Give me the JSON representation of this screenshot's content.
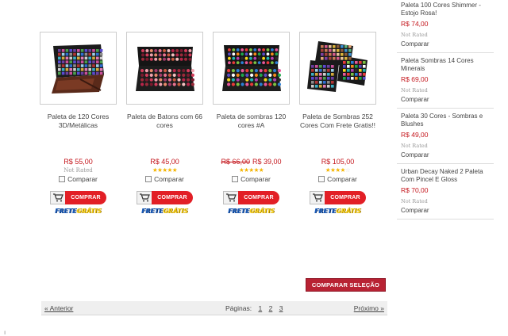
{
  "products": [
    {
      "name": "Paleta de 120 Cores 3D/Metálicas",
      "price": "R$ 55,00",
      "old_price": "",
      "rating_text": "Not Rated",
      "rating_stars": null,
      "compare_label": "Comparar",
      "buy_label": "COMPRAR",
      "frete_label": "FRETE",
      "frete_accent": "GRÁTIS",
      "image": "eyeshadow-palette-120-metallic"
    },
    {
      "name": "Paleta de Batons com 66 cores",
      "price": "R$ 45,00",
      "old_price": "",
      "rating_text": "",
      "rating_stars": 5,
      "compare_label": "Comparar",
      "buy_label": "COMPRAR",
      "frete_label": "FRETE",
      "frete_accent": "GRÁTIS",
      "image": "lipstick-palette-66"
    },
    {
      "name": "Paleta de sombras 120 cores #A",
      "price": "R$ 39,00",
      "old_price": "R$ 66,00",
      "rating_text": "",
      "rating_stars": 5,
      "compare_label": "Comparar",
      "buy_label": "COMPRAR",
      "frete_label": "FRETE",
      "frete_accent": "GRÁTIS",
      "image": "eyeshadow-palette-120a"
    },
    {
      "name": "Paleta de Sombras 252 Cores Com Frete Gratis!!",
      "price": "R$ 105,00",
      "old_price": "",
      "rating_text": "",
      "rating_stars": 4,
      "compare_label": "Comparar",
      "buy_label": "COMPRAR",
      "frete_label": "FRETE",
      "frete_accent": "GRÁTIS",
      "image": "eyeshadow-palette-252"
    }
  ],
  "compare_selection_label": "COMPARAR SELEÇÃO",
  "pagination": {
    "prev": "« Anterior",
    "label": "Páginas:",
    "pages": [
      "1",
      "2",
      "3"
    ],
    "next": "Próximo »"
  },
  "sidebar": [
    {
      "name": "Paleta 100 Cores Shimmer - Estojo Rosa!",
      "price": "R$ 74,00",
      "rating_text": "Not Rated",
      "compare_label": "Comparar"
    },
    {
      "name": "Paleta Sombras 14 Cores Minerais",
      "price": "R$ 69,00",
      "rating_text": "Not Rated",
      "compare_label": "Comparar"
    },
    {
      "name": "Paleta 30 Cores - Sombras e Blushes",
      "price": "R$ 49,00",
      "rating_text": "Not Rated",
      "compare_label": "Comparar"
    },
    {
      "name": "Urban Decay Naked 2 Paleta Com Pincel E Gloss",
      "price": "R$ 70,00",
      "rating_text": "Not Rated",
      "compare_label": "Comparar"
    }
  ],
  "colors": {
    "price": "#c4161c",
    "buy_button": "#e21f26",
    "compare_selection_button": "#b82233",
    "frete_text": "#1c5fbe",
    "frete_accent": "#f7d117",
    "star_on": "#f4b400"
  }
}
